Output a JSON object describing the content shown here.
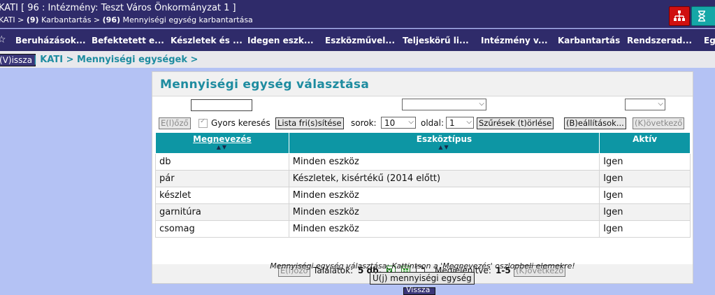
{
  "header": {
    "title": "KATI [ 96 : Intézmény: Teszt Város Önkormányzat 1 ]",
    "path_part1": "KATI > ",
    "path_bold1": "(9)",
    "path_part2": " Karbantartás > ",
    "path_bold2": "(96)",
    "path_part3": " Mennyiségi egység karbantartása",
    "icons": [
      "sitemap-icon",
      "hourglass-icon"
    ]
  },
  "nav": {
    "items": [
      "Beruházások...",
      "Befektetett e...",
      "Készletek és ...",
      "Idegen eszk...",
      "Eszközművel...",
      "Teljeskörű li...",
      "Intézmény v...",
      "Karbantartás",
      "Rendszerad...",
      "Eg"
    ]
  },
  "breadcrumb": {
    "back_label": "(V)issza",
    "path": "| KATI > Mennyiségi egységek >"
  },
  "panel": {
    "title": "Mennyiségi egység választása",
    "toolbar": {
      "prev": "E(l)őző",
      "quick_search": "Gyors keresés",
      "refresh": "Lista fri(s)sítése",
      "rows_label": "sorok:",
      "rows_value": "10",
      "page_label": "oldal:",
      "page_value": "1",
      "clear_filters": "Szűrések (t)örlése",
      "settings": "(B)eállítások...",
      "next": "(K)övetkező"
    },
    "columns": [
      "Megnevezés",
      "Eszköztípus",
      "Aktív"
    ],
    "rows": [
      [
        "db",
        "Minden eszköz",
        "Igen"
      ],
      [
        "pár",
        "Készletek, kisértékű (2014 előtt)",
        "Igen"
      ],
      [
        "készlet",
        "Minden eszköz",
        "Igen"
      ],
      [
        "garnitúra",
        "Minden eszköz",
        "Igen"
      ],
      [
        "csomag",
        "Minden eszköz",
        "Igen"
      ]
    ],
    "footer": {
      "prev": "E(l)őző",
      "results_label": "Találatok:",
      "results_value": "5 db.",
      "shown_label": "Megjelenítve:",
      "shown_value": "1-5",
      "next": "(K)övetkező"
    },
    "note": "Mennyiségi egység választása: Kattintson a 'Megnevezés' oszlopbeli elemekre!",
    "new_button": "Ú(j) mennyiségi egység"
  },
  "bottom_back": "Vissza"
}
